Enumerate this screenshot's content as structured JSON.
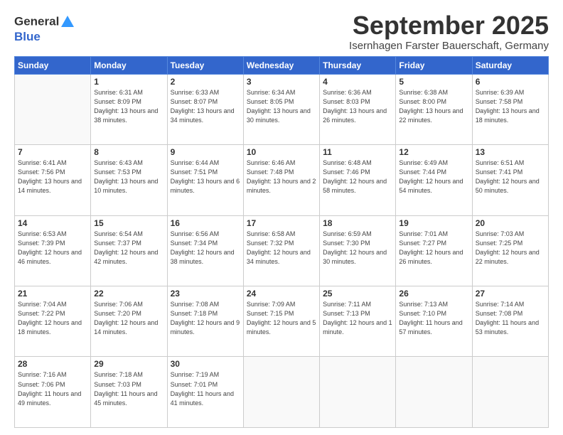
{
  "header": {
    "logo_line1": "General",
    "logo_line2": "Blue",
    "month": "September 2025",
    "location": "Isernhagen Farster Bauerschaft, Germany"
  },
  "weekdays": [
    "Sunday",
    "Monday",
    "Tuesday",
    "Wednesday",
    "Thursday",
    "Friday",
    "Saturday"
  ],
  "weeks": [
    [
      {
        "day": "",
        "sunrise": "",
        "sunset": "",
        "daylight": ""
      },
      {
        "day": "1",
        "sunrise": "Sunrise: 6:31 AM",
        "sunset": "Sunset: 8:09 PM",
        "daylight": "Daylight: 13 hours and 38 minutes."
      },
      {
        "day": "2",
        "sunrise": "Sunrise: 6:33 AM",
        "sunset": "Sunset: 8:07 PM",
        "daylight": "Daylight: 13 hours and 34 minutes."
      },
      {
        "day": "3",
        "sunrise": "Sunrise: 6:34 AM",
        "sunset": "Sunset: 8:05 PM",
        "daylight": "Daylight: 13 hours and 30 minutes."
      },
      {
        "day": "4",
        "sunrise": "Sunrise: 6:36 AM",
        "sunset": "Sunset: 8:03 PM",
        "daylight": "Daylight: 13 hours and 26 minutes."
      },
      {
        "day": "5",
        "sunrise": "Sunrise: 6:38 AM",
        "sunset": "Sunset: 8:00 PM",
        "daylight": "Daylight: 13 hours and 22 minutes."
      },
      {
        "day": "6",
        "sunrise": "Sunrise: 6:39 AM",
        "sunset": "Sunset: 7:58 PM",
        "daylight": "Daylight: 13 hours and 18 minutes."
      }
    ],
    [
      {
        "day": "7",
        "sunrise": "Sunrise: 6:41 AM",
        "sunset": "Sunset: 7:56 PM",
        "daylight": "Daylight: 13 hours and 14 minutes."
      },
      {
        "day": "8",
        "sunrise": "Sunrise: 6:43 AM",
        "sunset": "Sunset: 7:53 PM",
        "daylight": "Daylight: 13 hours and 10 minutes."
      },
      {
        "day": "9",
        "sunrise": "Sunrise: 6:44 AM",
        "sunset": "Sunset: 7:51 PM",
        "daylight": "Daylight: 13 hours and 6 minutes."
      },
      {
        "day": "10",
        "sunrise": "Sunrise: 6:46 AM",
        "sunset": "Sunset: 7:48 PM",
        "daylight": "Daylight: 13 hours and 2 minutes."
      },
      {
        "day": "11",
        "sunrise": "Sunrise: 6:48 AM",
        "sunset": "Sunset: 7:46 PM",
        "daylight": "Daylight: 12 hours and 58 minutes."
      },
      {
        "day": "12",
        "sunrise": "Sunrise: 6:49 AM",
        "sunset": "Sunset: 7:44 PM",
        "daylight": "Daylight: 12 hours and 54 minutes."
      },
      {
        "day": "13",
        "sunrise": "Sunrise: 6:51 AM",
        "sunset": "Sunset: 7:41 PM",
        "daylight": "Daylight: 12 hours and 50 minutes."
      }
    ],
    [
      {
        "day": "14",
        "sunrise": "Sunrise: 6:53 AM",
        "sunset": "Sunset: 7:39 PM",
        "daylight": "Daylight: 12 hours and 46 minutes."
      },
      {
        "day": "15",
        "sunrise": "Sunrise: 6:54 AM",
        "sunset": "Sunset: 7:37 PM",
        "daylight": "Daylight: 12 hours and 42 minutes."
      },
      {
        "day": "16",
        "sunrise": "Sunrise: 6:56 AM",
        "sunset": "Sunset: 7:34 PM",
        "daylight": "Daylight: 12 hours and 38 minutes."
      },
      {
        "day": "17",
        "sunrise": "Sunrise: 6:58 AM",
        "sunset": "Sunset: 7:32 PM",
        "daylight": "Daylight: 12 hours and 34 minutes."
      },
      {
        "day": "18",
        "sunrise": "Sunrise: 6:59 AM",
        "sunset": "Sunset: 7:30 PM",
        "daylight": "Daylight: 12 hours and 30 minutes."
      },
      {
        "day": "19",
        "sunrise": "Sunrise: 7:01 AM",
        "sunset": "Sunset: 7:27 PM",
        "daylight": "Daylight: 12 hours and 26 minutes."
      },
      {
        "day": "20",
        "sunrise": "Sunrise: 7:03 AM",
        "sunset": "Sunset: 7:25 PM",
        "daylight": "Daylight: 12 hours and 22 minutes."
      }
    ],
    [
      {
        "day": "21",
        "sunrise": "Sunrise: 7:04 AM",
        "sunset": "Sunset: 7:22 PM",
        "daylight": "Daylight: 12 hours and 18 minutes."
      },
      {
        "day": "22",
        "sunrise": "Sunrise: 7:06 AM",
        "sunset": "Sunset: 7:20 PM",
        "daylight": "Daylight: 12 hours and 14 minutes."
      },
      {
        "day": "23",
        "sunrise": "Sunrise: 7:08 AM",
        "sunset": "Sunset: 7:18 PM",
        "daylight": "Daylight: 12 hours and 9 minutes."
      },
      {
        "day": "24",
        "sunrise": "Sunrise: 7:09 AM",
        "sunset": "Sunset: 7:15 PM",
        "daylight": "Daylight: 12 hours and 5 minutes."
      },
      {
        "day": "25",
        "sunrise": "Sunrise: 7:11 AM",
        "sunset": "Sunset: 7:13 PM",
        "daylight": "Daylight: 12 hours and 1 minute."
      },
      {
        "day": "26",
        "sunrise": "Sunrise: 7:13 AM",
        "sunset": "Sunset: 7:10 PM",
        "daylight": "Daylight: 11 hours and 57 minutes."
      },
      {
        "day": "27",
        "sunrise": "Sunrise: 7:14 AM",
        "sunset": "Sunset: 7:08 PM",
        "daylight": "Daylight: 11 hours and 53 minutes."
      }
    ],
    [
      {
        "day": "28",
        "sunrise": "Sunrise: 7:16 AM",
        "sunset": "Sunset: 7:06 PM",
        "daylight": "Daylight: 11 hours and 49 minutes."
      },
      {
        "day": "29",
        "sunrise": "Sunrise: 7:18 AM",
        "sunset": "Sunset: 7:03 PM",
        "daylight": "Daylight: 11 hours and 45 minutes."
      },
      {
        "day": "30",
        "sunrise": "Sunrise: 7:19 AM",
        "sunset": "Sunset: 7:01 PM",
        "daylight": "Daylight: 11 hours and 41 minutes."
      },
      {
        "day": "",
        "sunrise": "",
        "sunset": "",
        "daylight": ""
      },
      {
        "day": "",
        "sunrise": "",
        "sunset": "",
        "daylight": ""
      },
      {
        "day": "",
        "sunrise": "",
        "sunset": "",
        "daylight": ""
      },
      {
        "day": "",
        "sunrise": "",
        "sunset": "",
        "daylight": ""
      }
    ]
  ]
}
